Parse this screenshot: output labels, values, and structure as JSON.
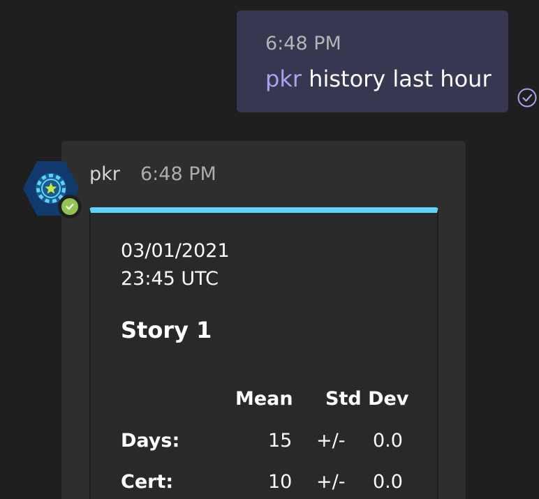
{
  "sent_message": {
    "time": "6:48 PM",
    "mention": "pkr",
    "text": " history last hour"
  },
  "bot_message": {
    "sender": "pkr",
    "time": "6:48 PM",
    "card": {
      "date": "03/01/2021",
      "time": "23:45 UTC",
      "title": "Story 1",
      "accent_color": "#5dd3fc",
      "columns": {
        "mean": "Mean",
        "std_dev": "Std Dev"
      },
      "rows": [
        {
          "label": "Days:",
          "mean": "15",
          "pm": "+/-",
          "std": "0.0"
        },
        {
          "label": "Cert:",
          "mean": "10",
          "pm": "+/-",
          "std": "0.0"
        }
      ]
    }
  },
  "icons": {
    "read_receipt": "check-circle-icon",
    "avatar": "poker-chip-icon",
    "status": "checkmark-icon"
  },
  "colors": {
    "background": "#1f1f1f",
    "sent_bubble": "#373751",
    "mention": "#a6a6ef",
    "bot_bubble": "#2f2e2e",
    "status_available": "#92c353"
  }
}
